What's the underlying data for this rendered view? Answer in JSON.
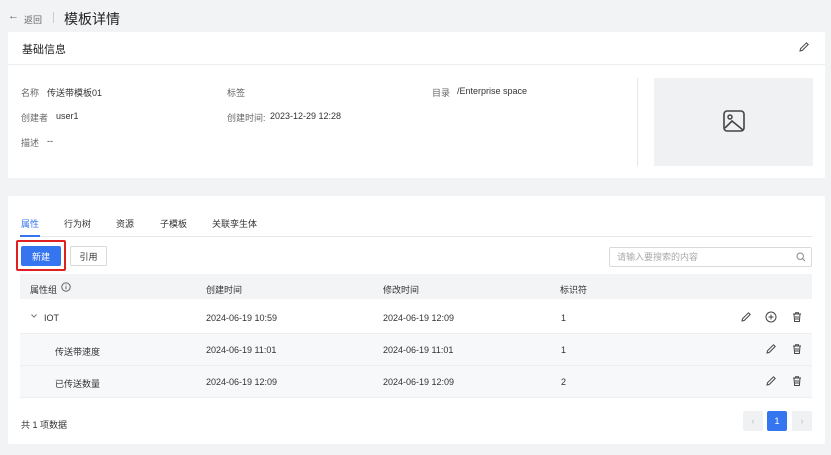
{
  "header": {
    "back_label": "返回",
    "title": "模板详情"
  },
  "basic_info": {
    "title": "基础信息",
    "name_label": "名称",
    "name_value": "传送带模板01",
    "tag_label": "标签",
    "dir_label": "目录",
    "dir_value": "/Enterprise space",
    "creator_label": "创建者",
    "creator_value": "user1",
    "created_label": "创建时间:",
    "created_value": "2023-12-29 12:28",
    "desc_label": "描述",
    "desc_value": "--"
  },
  "tabs": [
    "属性",
    "行为树",
    "资源",
    "子模板",
    "关联孪生体"
  ],
  "toolbar": {
    "new_label": "新建",
    "ref_label": "引用",
    "search_placeholder": "请输入要搜索的内容"
  },
  "table": {
    "headers": [
      "属性组",
      "创建时间",
      "修改时间",
      "标识符"
    ],
    "rows": [
      {
        "name": "IOT",
        "created": "2024-06-19 10:59",
        "modified": "2024-06-19 12:09",
        "id": "1"
      },
      {
        "name": "传送带速度",
        "created": "2024-06-19 11:01",
        "modified": "2024-06-19 11:01",
        "id": "1"
      },
      {
        "name": "已传送数量",
        "created": "2024-06-19 12:09",
        "modified": "2024-06-19 12:09",
        "id": "2"
      }
    ]
  },
  "pagination": {
    "total_text": "共 1 项数据",
    "current_page": "1",
    "prev": "‹",
    "next": "›"
  },
  "icons": {
    "back": "arrow-left-icon",
    "edit": "pencil-icon",
    "image": "image-placeholder-icon",
    "info": "info-circle-icon",
    "search": "search-icon",
    "chevron": "chevron-down-icon",
    "add": "plus-circle-icon",
    "delete": "trash-icon"
  },
  "colors": {
    "primary": "#3575f0",
    "highlight_border": "#e02020"
  }
}
